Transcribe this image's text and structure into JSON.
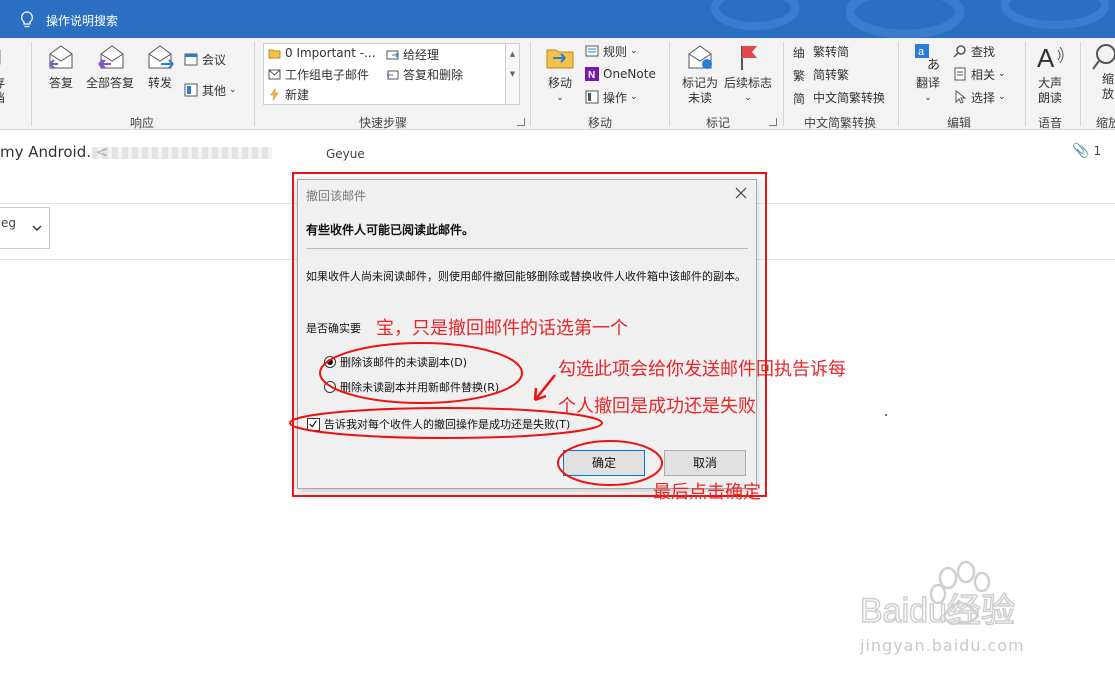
{
  "titlebar": {
    "search_hint": "操作说明搜索"
  },
  "ribbon": {
    "partial_left": {
      "line1": "存",
      "line2": "档"
    },
    "respond": {
      "label": "响应",
      "reply": "答复",
      "reply_all": "全部答复",
      "forward": "转发",
      "meeting": "会议",
      "more": "其他"
    },
    "quick_steps": {
      "label": "快速步骤",
      "items": [
        "0 Important -...",
        "给经理",
        "工作组电子邮件",
        "答复和删除",
        "新建"
      ]
    },
    "move": {
      "label": "移动",
      "move": "移动",
      "rules": "规则",
      "onenote": "OneNote",
      "actions": "操作"
    },
    "tags": {
      "label": "标记",
      "mark_unread_line1": "标记为",
      "mark_unread_line2": "未读",
      "follow_up": "后续标志"
    },
    "chinese_conversion": {
      "label": "中文简繁转换",
      "to_simplified": "繁转简",
      "to_traditional": "简转繁",
      "convert": "中文简繁转换"
    },
    "editing": {
      "label": "编辑",
      "translate": "翻译",
      "find": "查找",
      "related": "相关",
      "select": "选择"
    },
    "speech": {
      "label": "语音",
      "read_aloud_line1": "大声",
      "read_aloud_line2": "朗读"
    },
    "partial_right": {
      "line1": "缩",
      "line2": "放",
      "label": "缩放"
    }
  },
  "mail": {
    "from_prefix": "my Android. <",
    "to": "Geyue",
    "attachment_count": "1",
    "attachment_partial": "eg"
  },
  "dialog": {
    "title": "撤回该邮件",
    "heading": "有些收件人可能已阅读此邮件。",
    "description": "如果收件人尚未阅读邮件，则使用邮件撤回能够删除或替换收件人收件箱中该邮件的副本。",
    "confirm_question": "是否确实要",
    "option_delete": "删除该邮件的未读副本(D)",
    "option_replace": "删除未读副本并用新邮件替换(R)",
    "selected_option": "option_delete",
    "notify_checkbox": "告诉我对每个收件人的撤回操作是成功还是失败(T)",
    "notify_checked": true,
    "ok": "确定",
    "cancel": "取消"
  },
  "annotations": {
    "note_first_option": "宝，只是撤回邮件的话选第一个",
    "note_checkbox_line1": "勾选此项会给你发送邮件回执告诉每",
    "note_checkbox_line2": "个人撤回是成功还是失败",
    "note_ok": "最后点击确定",
    "color": "#e8262a"
  },
  "watermark": {
    "brand": "Baidu经验",
    "url": "jingyan.baidu.com"
  }
}
